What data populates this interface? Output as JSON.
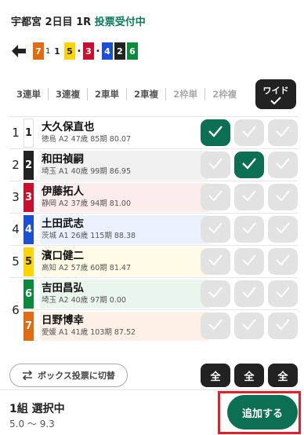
{
  "header": {
    "race": "宇都宮 2日目 1R",
    "status": "投票受付中"
  },
  "order": [
    {
      "num": "7",
      "bg": "#e06b10",
      "fg": "#ffffff",
      "sep": "1"
    },
    {
      "num": "1",
      "bg": "#ffffff",
      "fg": "#222222",
      "sep": ""
    },
    {
      "num": "5",
      "bg": "#ffd500",
      "fg": "#222222",
      "sep": "•"
    },
    {
      "num": "3",
      "bg": "#c8102e",
      "fg": "#ffffff",
      "sep": "•"
    },
    {
      "num": "4",
      "bg": "#1a4fd6",
      "fg": "#ffffff",
      "sep": ""
    },
    {
      "num": "2",
      "bg": "#222222",
      "fg": "#ffffff",
      "sep": ""
    },
    {
      "num": "6",
      "bg": "#0a8a3a",
      "fg": "#ffffff",
      "sep": ""
    }
  ],
  "tabs": [
    "3連単",
    "3連複",
    "2車単",
    "2車複",
    "2枠単",
    "2枠複"
  ],
  "tab_active": "ワイド",
  "riders": [
    {
      "frame": "1",
      "num": "1",
      "name": "大久保直也",
      "detail": "徳島 A2 47歳 85期 80.07",
      "bg": "#ffffff",
      "num_bg": "#ffffff",
      "num_fg": "#222222",
      "checks": [
        true,
        false,
        false
      ]
    },
    {
      "frame": "2",
      "num": "2",
      "name": "和田禎嗣",
      "detail": "埼玉 A1 40歳 99期 86.95",
      "bg": "#f0f0f0",
      "num_bg": "#222222",
      "num_fg": "#ffffff",
      "checks": [
        false,
        true,
        false
      ]
    },
    {
      "frame": "3",
      "num": "3",
      "name": "伊藤拓人",
      "detail": "静岡 A2 37歳 94期 81.00",
      "bg": "#fdecec",
      "num_bg": "#c8102e",
      "num_fg": "#ffffff",
      "checks": [
        false,
        false,
        false
      ]
    },
    {
      "frame": "4",
      "num": "4",
      "name": "土田武志",
      "detail": "茨城 A1 26歳 115期 88.38",
      "bg": "#eaf1fd",
      "num_bg": "#1a4fd6",
      "num_fg": "#ffffff",
      "checks": [
        false,
        false,
        false
      ]
    },
    {
      "frame": "5",
      "num": "5",
      "name": "濱口健二",
      "detail": "高知 A2 57歳 60期 81.47",
      "bg": "#fffbe6",
      "num_bg": "#ffd500",
      "num_fg": "#222222",
      "checks": [
        false,
        false,
        false
      ]
    },
    {
      "frame": "6",
      "num": "6",
      "name": "吉田昌弘",
      "detail": "埼玉 A2 40歳 97期 0.00",
      "bg": "#eaf6ed",
      "num_bg": "#0a8a3a",
      "num_fg": "#ffffff",
      "checks": [
        false,
        false,
        false
      ]
    },
    {
      "frame": "6",
      "num": "7",
      "name": "日野博幸",
      "detail": "愛媛 A1 41歳 103期 87.52",
      "bg": "#fdf0e6",
      "num_bg": "#e06b10",
      "num_fg": "#ffffff",
      "checks": [
        false,
        false,
        false
      ]
    }
  ],
  "box_button": "ボックス投票に切替",
  "all_label": "全",
  "footer": {
    "selection": "1組 選択中",
    "odds": "5.0 〜 9.3",
    "add": "追加する"
  },
  "colors": {
    "accent": "#0b6f52",
    "highlight": "#e0202a"
  }
}
